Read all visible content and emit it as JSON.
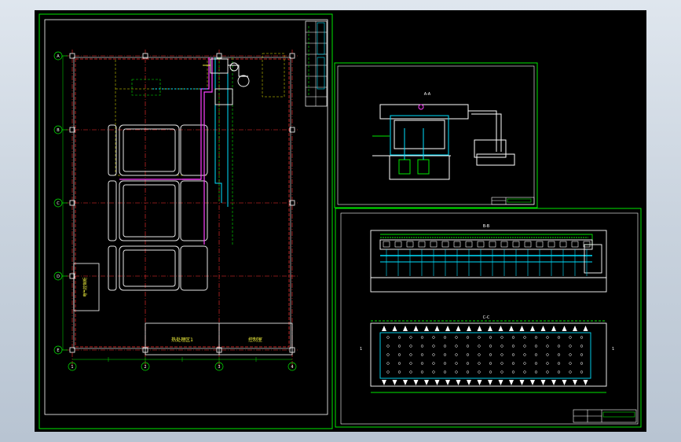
{
  "viewport": {
    "background": "#000000"
  },
  "colors": {
    "frame": "#00e600",
    "wall": "#d9d9d9",
    "axis": "#ff3030",
    "duct_magenta": "#ff40ff",
    "duct_cyan": "#00e0ff",
    "equipment": "#ffffff",
    "label": "#ffff40"
  },
  "sheets": {
    "left": {
      "title_block_rows": 8,
      "axis_bubbles_left": [
        "A",
        "B",
        "C",
        "D",
        "E"
      ],
      "axis_bubbles_bottom": [
        "1",
        "2",
        "3",
        "4"
      ],
      "room_labels": [
        "热处理区1",
        "控制室"
      ],
      "vertical_note": "电气控制柜"
    },
    "top_right": {
      "view_label": "A-A"
    },
    "bottom_right": {
      "elevation_label": "B-B",
      "plan_label": "C-C",
      "section_mark_left": "1",
      "section_mark_right": "1"
    }
  }
}
